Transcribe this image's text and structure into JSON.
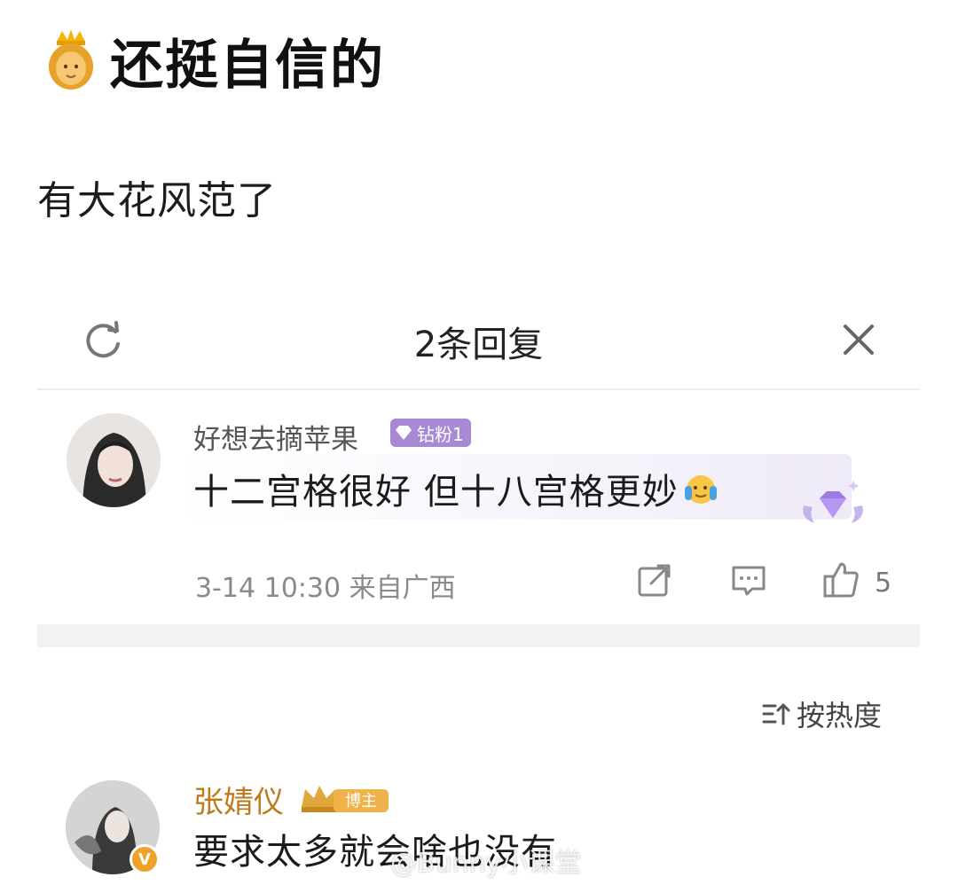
{
  "caption": {
    "title": "还挺自信的",
    "subtitle": "有大花风范了"
  },
  "panel": {
    "title": "2条回复"
  },
  "reply": {
    "username": "好想去摘苹果",
    "fan_badge": "钻粉1",
    "text": "十二宫格很好 但十八宫格更妙",
    "timestamp": "3-14 10:30 来自广西",
    "like_count": "5"
  },
  "sort": {
    "label": "按热度"
  },
  "main_comment": {
    "username": "张婧仪",
    "author_badge": "博主",
    "text": "要求太多就会啥也没有"
  },
  "watermark": "@Bunny小课堂",
  "icons": {
    "refresh": "refresh-icon",
    "close": "close-icon",
    "share": "share-icon",
    "comment": "comment-icon",
    "like": "thumbs-up-icon",
    "sort": "sort-icon",
    "verified": "verified-v-icon"
  },
  "colors": {
    "fan_badge": "#a789d4",
    "author_name": "#c07a1e",
    "verified": "#f0a12a"
  }
}
